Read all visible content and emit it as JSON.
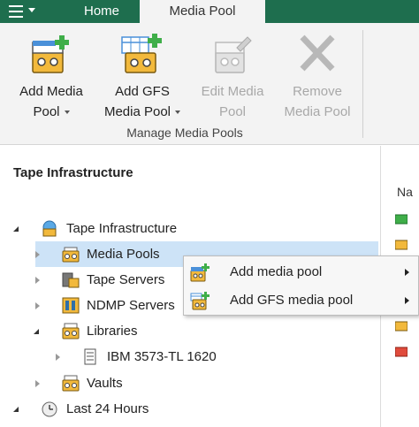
{
  "topbar": {
    "menu_icon": "hamburger-menu-icon",
    "tabs": [
      {
        "label": "Home",
        "active": false
      },
      {
        "label": "Media Pool",
        "active": true
      }
    ],
    "colors": {
      "bar": "#1e6e4e",
      "active_tab": "#f3f3f3"
    }
  },
  "ribbon": {
    "buttons": [
      {
        "line1": "Add Media",
        "line2": "Pool",
        "dropdown": true,
        "enabled": true,
        "icon": "add-media-pool-icon"
      },
      {
        "line1": "Add GFS",
        "line2": "Media Pool",
        "dropdown": true,
        "enabled": true,
        "icon": "add-gfs-media-pool-icon"
      },
      {
        "line1": "Edit Media",
        "line2": "Pool",
        "dropdown": false,
        "enabled": false,
        "icon": "edit-media-pool-icon"
      },
      {
        "line1": "Remove",
        "line2": "Media Pool",
        "dropdown": false,
        "enabled": false,
        "icon": "remove-icon"
      }
    ],
    "group_label": "Manage Media Pools"
  },
  "left_pane": {
    "title": "Tape Infrastructure",
    "tree": [
      {
        "label": "Tape Infrastructure",
        "expander": "open",
        "icon": "tape-infrastructure-icon",
        "level": 0,
        "selected": false
      },
      {
        "label": "Media Pools",
        "expander": "closed",
        "icon": "media-pools-icon",
        "level": 1,
        "selected": true
      },
      {
        "label": "Tape Servers",
        "expander": "closed",
        "icon": "tape-servers-icon",
        "level": 1,
        "selected": false
      },
      {
        "label": "NDMP Servers",
        "expander": "closed",
        "icon": "ndmp-servers-icon",
        "level": 1,
        "selected": false
      },
      {
        "label": "Libraries",
        "expander": "open",
        "icon": "libraries-icon",
        "level": 1,
        "selected": false
      },
      {
        "label": "IBM 3573-TL 1620",
        "expander": "closed",
        "icon": "tape-library-icon",
        "level": 2,
        "selected": false
      },
      {
        "label": "Vaults",
        "expander": "closed",
        "icon": "vaults-icon",
        "level": 1,
        "selected": false
      },
      {
        "label": "Last 24 Hours",
        "expander": "open",
        "icon": "last-24-hours-icon",
        "level": 0,
        "selected": false
      }
    ]
  },
  "right_pane": {
    "column_header": "Na"
  },
  "context_menu": {
    "items": [
      {
        "label": "Add media pool",
        "icon": "add-media-pool-icon",
        "has_submenu": true
      },
      {
        "label": "Add GFS media pool",
        "icon": "add-gfs-media-pool-icon",
        "has_submenu": true
      }
    ]
  }
}
